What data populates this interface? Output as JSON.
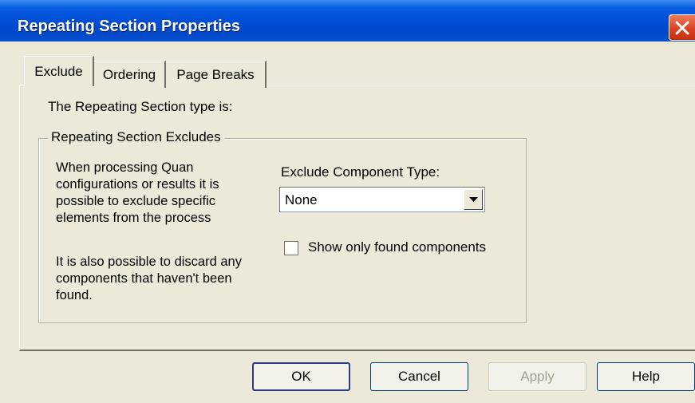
{
  "window": {
    "title": "Repeating Section Properties",
    "close_icon": "close-icon"
  },
  "tabs": [
    {
      "label": "Exclude",
      "active": true
    },
    {
      "label": "Ordering",
      "active": false
    },
    {
      "label": "Page Breaks",
      "active": false
    }
  ],
  "exclude_tab": {
    "type_label": "The Repeating Section type is:",
    "group_label": "Repeating Section Excludes",
    "description_1": "When processing Quan configurations or results it is possible to exclude specific elements from the process",
    "description_2": "It is also possible to discard any components that haven't been found.",
    "component_type_label": "Exclude Component Type:",
    "component_type_value": "None",
    "show_found_label": "Show only found components",
    "show_found_checked": false
  },
  "buttons": {
    "ok": "OK",
    "cancel": "Cancel",
    "apply": "Apply",
    "help": "Help"
  },
  "colors": {
    "titlebar": "#0050d6",
    "dialog_background": "#ece9d8",
    "close_button": "#d8401e"
  }
}
